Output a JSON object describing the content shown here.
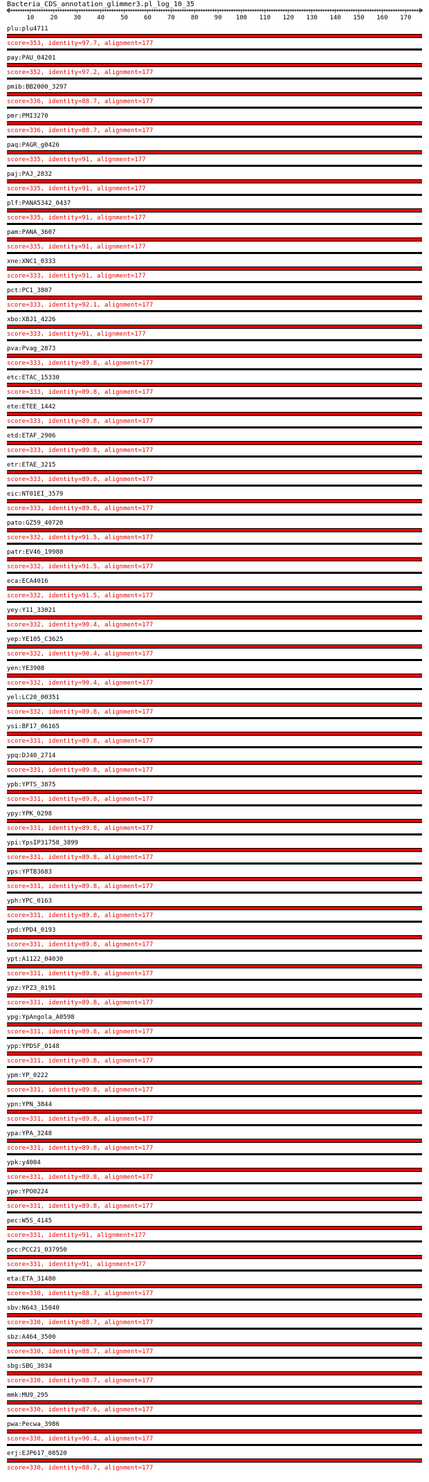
{
  "title": "Bacteria_CDS_annotation_glimmer3.pl_log_10_35",
  "ruler": {
    "ticks": [
      "10",
      "20",
      "30",
      "40",
      "50",
      "60",
      "70",
      "80",
      "90",
      "100",
      "110",
      "120",
      "130",
      "140",
      "150",
      "160",
      "170"
    ],
    "max": 177
  },
  "hits": [
    {
      "name": "plu:plu4711",
      "score": "score=353, identity=97.7, alignment=177"
    },
    {
      "name": "pay:PAU_04201",
      "score": "score=352, identity=97.2, alignment=177"
    },
    {
      "name": "pmib:BB2000_3297",
      "score": "score=336, identity=88.7, alignment=177"
    },
    {
      "name": "pmr:PMI3270",
      "score": "score=336, identity=88.7, alignment=177"
    },
    {
      "name": "paq:PAGR_g0426",
      "score": "score=335, identity=91, alignment=177"
    },
    {
      "name": "paj:PAJ_2832",
      "score": "score=335, identity=91, alignment=177"
    },
    {
      "name": "plf:PANA5342_0437",
      "score": "score=335, identity=91, alignment=177"
    },
    {
      "name": "pam:PANA_3607",
      "score": "score=335, identity=91, alignment=177"
    },
    {
      "name": "xne:XNC1_0333",
      "score": "score=333, identity=91, alignment=177"
    },
    {
      "name": "pct:PC1_3807",
      "score": "score=333, identity=92.1, alignment=177"
    },
    {
      "name": "xbo:XBJ1_4226",
      "score": "score=333, identity=91, alignment=177"
    },
    {
      "name": "pva:Pvag_2873",
      "score": "score=333, identity=89.8, alignment=177"
    },
    {
      "name": "etc:ETAC_15330",
      "score": "score=333, identity=89.8, alignment=177"
    },
    {
      "name": "ete:ETEE_1442",
      "score": "score=333, identity=89.8, alignment=177"
    },
    {
      "name": "etd:ETAF_2906",
      "score": "score=333, identity=89.8, alignment=177"
    },
    {
      "name": "etr:ETAE_3215",
      "score": "score=333, identity=89.8, alignment=177"
    },
    {
      "name": "eic:NT01EI_3579",
      "score": "score=333, identity=89.8, alignment=177"
    },
    {
      "name": "pato:GZ59_40720",
      "score": "score=332, identity=91.5, alignment=177"
    },
    {
      "name": "patr:EV46_19980",
      "score": "score=332, identity=91.5, alignment=177"
    },
    {
      "name": "eca:ECA4016",
      "score": "score=332, identity=91.5, alignment=177"
    },
    {
      "name": "yey:Y11_33021",
      "score": "score=332, identity=90.4, alignment=177"
    },
    {
      "name": "yep:YE105_C3625",
      "score": "score=332, identity=90.4, alignment=177"
    },
    {
      "name": "yen:YE3908",
      "score": "score=332, identity=90.4, alignment=177"
    },
    {
      "name": "yel:LC20_00351",
      "score": "score=332, identity=89.8, alignment=177"
    },
    {
      "name": "ysi:BF17_06165",
      "score": "score=331, identity=89.8, alignment=177"
    },
    {
      "name": "ypq:DJ40_2714",
      "score": "score=331, identity=89.8, alignment=177"
    },
    {
      "name": "ypb:YPTS_3875",
      "score": "score=331, identity=89.8, alignment=177"
    },
    {
      "name": "ypy:YPK_0298",
      "score": "score=331, identity=89.8, alignment=177"
    },
    {
      "name": "ypi:YpsIP31758_3899",
      "score": "score=331, identity=89.8, alignment=177"
    },
    {
      "name": "yps:YPTB3683",
      "score": "score=331, identity=89.8, alignment=177"
    },
    {
      "name": "yph:YPC_0163",
      "score": "score=331, identity=89.8, alignment=177"
    },
    {
      "name": "ypd:YPD4_0193",
      "score": "score=331, identity=89.8, alignment=177"
    },
    {
      "name": "ypt:A1122_04030",
      "score": "score=331, identity=89.8, alignment=177"
    },
    {
      "name": "ypz:YPZ3_0191",
      "score": "score=331, identity=89.8, alignment=177"
    },
    {
      "name": "ypg:YpAngola_A0598",
      "score": "score=331, identity=89.8, alignment=177"
    },
    {
      "name": "ypp:YPDSF_0148",
      "score": "score=331, identity=89.8, alignment=177"
    },
    {
      "name": "ypm:YP_0222",
      "score": "score=331, identity=89.8, alignment=177"
    },
    {
      "name": "ypn:YPN_3844",
      "score": "score=331, identity=89.8, alignment=177"
    },
    {
      "name": "ypa:YPA_3248",
      "score": "score=331, identity=89.8, alignment=177"
    },
    {
      "name": "ypk:y4004",
      "score": "score=331, identity=89.8, alignment=177"
    },
    {
      "name": "ype:YPO0224",
      "score": "score=331, identity=89.8, alignment=177"
    },
    {
      "name": "pec:W5S_4145",
      "score": "score=331, identity=91, alignment=177"
    },
    {
      "name": "pcc:PCC21_037950",
      "score": "score=331, identity=91, alignment=177"
    },
    {
      "name": "eta:ETA_31480",
      "score": "score=330, identity=88.7, alignment=177"
    },
    {
      "name": "sbv:N643_15040",
      "score": "score=330, identity=88.7, alignment=177"
    },
    {
      "name": "sbz:A464_3500",
      "score": "score=330, identity=88.7, alignment=177"
    },
    {
      "name": "sbg:SBG_3034",
      "score": "score=330, identity=88.7, alignment=177"
    },
    {
      "name": "mmk:MU9_295",
      "score": "score=330, identity=87.6, alignment=177"
    },
    {
      "name": "pwa:Pecwa_3986",
      "score": "score=330, identity=90.4, alignment=177"
    },
    {
      "name": "erj:EJP617_08520",
      "score": "score=330, identity=88.7, alignment=177"
    }
  ],
  "colors": {
    "score_text": "#e80000",
    "bar_fill": "#e80000",
    "text": "#000000"
  }
}
